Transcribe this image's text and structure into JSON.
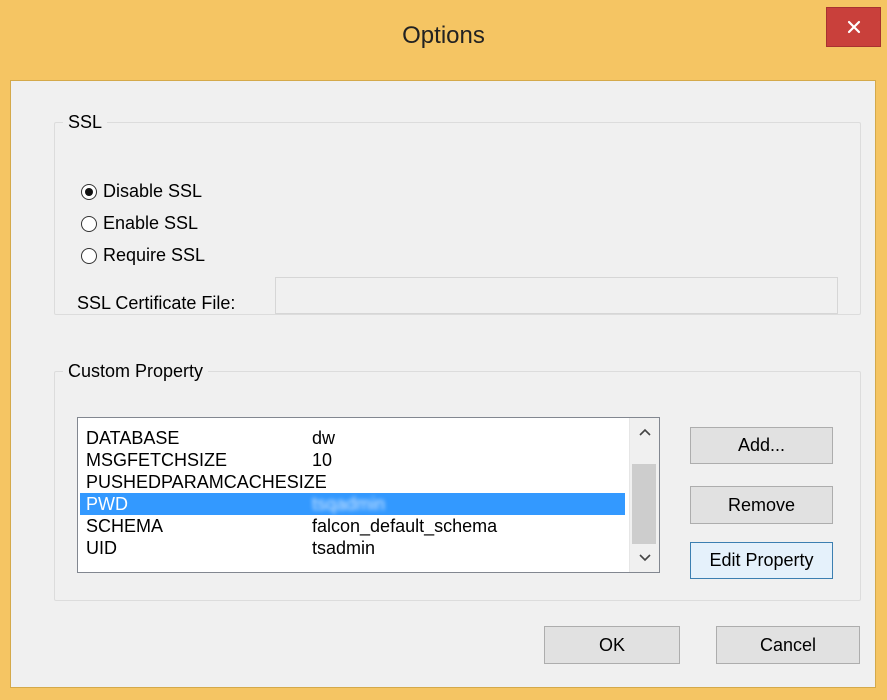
{
  "window": {
    "title": "Options",
    "close_glyph": "✕",
    "title_bar_color": "#f5c563",
    "close_button_color": "#c9403b"
  },
  "ssl": {
    "group_label": "SSL",
    "options": [
      {
        "label": "Disable SSL",
        "selected": true
      },
      {
        "label": "Enable SSL",
        "selected": false
      },
      {
        "label": "Require SSL",
        "selected": false
      }
    ],
    "certificate_label": "SSL Certificate File:",
    "certificate_value": ""
  },
  "custom_property": {
    "group_label": "Custom Property",
    "rows": [
      {
        "key": "DATABASE",
        "value": "dw"
      },
      {
        "key": "MSGFETCHSIZE",
        "value": "10"
      },
      {
        "key": "PUSHEDPARAMCACHESIZE",
        "value": ""
      },
      {
        "key": "PWD",
        "value": "tsqadmin",
        "selected": true
      },
      {
        "key": "SCHEMA",
        "value": "falcon_default_schema"
      },
      {
        "key": "UID",
        "value": "tsadmin"
      }
    ],
    "selection_color": "#3399ff",
    "add_label": "Add...",
    "remove_label": "Remove",
    "edit_label": "Edit Property"
  },
  "footer": {
    "ok_label": "OK",
    "cancel_label": "Cancel"
  },
  "icons": {
    "close": "close-icon",
    "scroll_up": "chevron-up-icon",
    "scroll_down": "chevron-down-icon"
  }
}
